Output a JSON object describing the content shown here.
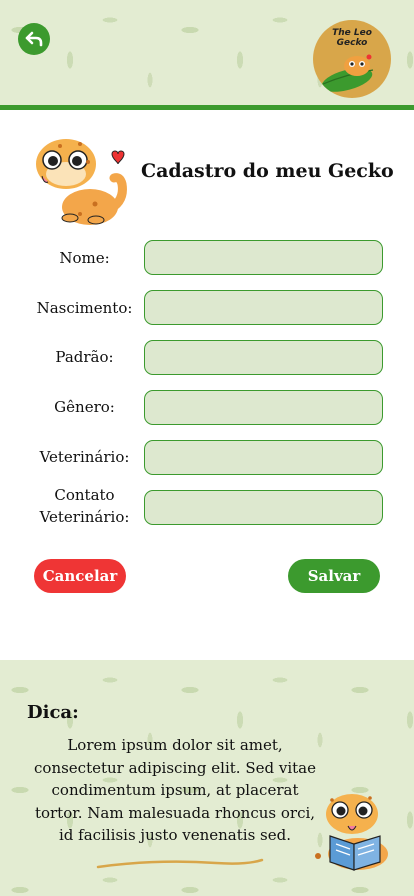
{
  "header": {
    "back_icon": "back-arrow-icon",
    "logo_text_line1": "The Leo",
    "logo_text_line2": "Gecko"
  },
  "page": {
    "title": "Cadastro do meu Gecko",
    "mascot": "gecko-with-heart-illustration"
  },
  "form": {
    "fields": [
      {
        "label": "Nome:",
        "value": ""
      },
      {
        "label": "Nascimento:",
        "value": ""
      },
      {
        "label": "Padrão:",
        "value": ""
      },
      {
        "label": "Gênero:",
        "value": ""
      },
      {
        "label": "Veterinário:",
        "value": ""
      },
      {
        "label_line1": "Contato",
        "label_line2": "Veterinário:",
        "value": ""
      }
    ]
  },
  "actions": {
    "cancel_label": "Cancelar",
    "save_label": "Salvar"
  },
  "tip": {
    "title": "Dica:",
    "body": "Lorem ipsum dolor sit amet, consectetur adipiscing elit. Sed vitae condimentum ipsum, at placerat tortor. Nam malesuada rhoncus orci, id facilisis justo venenatis sed.",
    "mascot": "gecko-reading-book-illustration"
  },
  "colors": {
    "primary_green": "#3c9a2e",
    "cancel_red": "#ef3535",
    "input_fill": "#dde8cf",
    "background_leaf": "#e3ecd2"
  }
}
